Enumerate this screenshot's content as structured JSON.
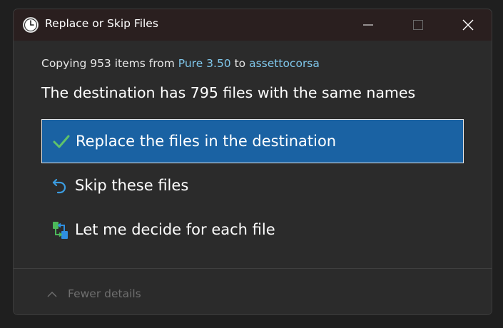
{
  "window": {
    "title": "Replace or Skip Files",
    "icon": "clock-icon"
  },
  "controls": {
    "minimize": "minimize-icon",
    "maximize": "maximize-icon",
    "close": "close-icon"
  },
  "copy_info": {
    "prefix": "Copying 953 items from",
    "source": "Pure 3.50",
    "connector": "to",
    "destination": "assettocorsa"
  },
  "headline": "The destination has 795 files with the same names",
  "options": [
    {
      "label": "Replace the files in the destination",
      "icon": "checkmark-icon",
      "selected": true
    },
    {
      "label": "Skip these files",
      "icon": "undo-arrow-icon",
      "selected": false
    },
    {
      "label": "Let me decide for each file",
      "icon": "compare-files-icon",
      "selected": false
    }
  ],
  "footer": {
    "details_label": "Fewer details",
    "icon": "chevron-up-icon"
  },
  "colors": {
    "accent": "#1a62a3",
    "link": "#7fc6ea",
    "check": "#5fc26a",
    "undo": "#3b9ce0"
  }
}
